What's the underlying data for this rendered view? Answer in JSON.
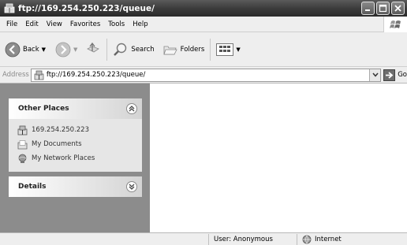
{
  "window": {
    "title": "ftp://169.254.250.223/queue/"
  },
  "menu": [
    "File",
    "Edit",
    "View",
    "Favorites",
    "Tools",
    "Help"
  ],
  "toolbar": {
    "back_label": "Back",
    "search_label": "Search",
    "folders_label": "Folders"
  },
  "address": {
    "label": "Address",
    "value": "ftp://169.254.250.223/queue/",
    "go_label": "Go"
  },
  "other_places": {
    "title": "Other Places",
    "items": [
      {
        "label": "169.254.250.223",
        "icon": "ftp-server-icon"
      },
      {
        "label": "My Documents",
        "icon": "my-documents-icon"
      },
      {
        "label": "My Network Places",
        "icon": "network-places-icon"
      }
    ]
  },
  "details": {
    "title": "Details"
  },
  "status": {
    "user": "User: Anonymous",
    "zone": "Internet"
  }
}
